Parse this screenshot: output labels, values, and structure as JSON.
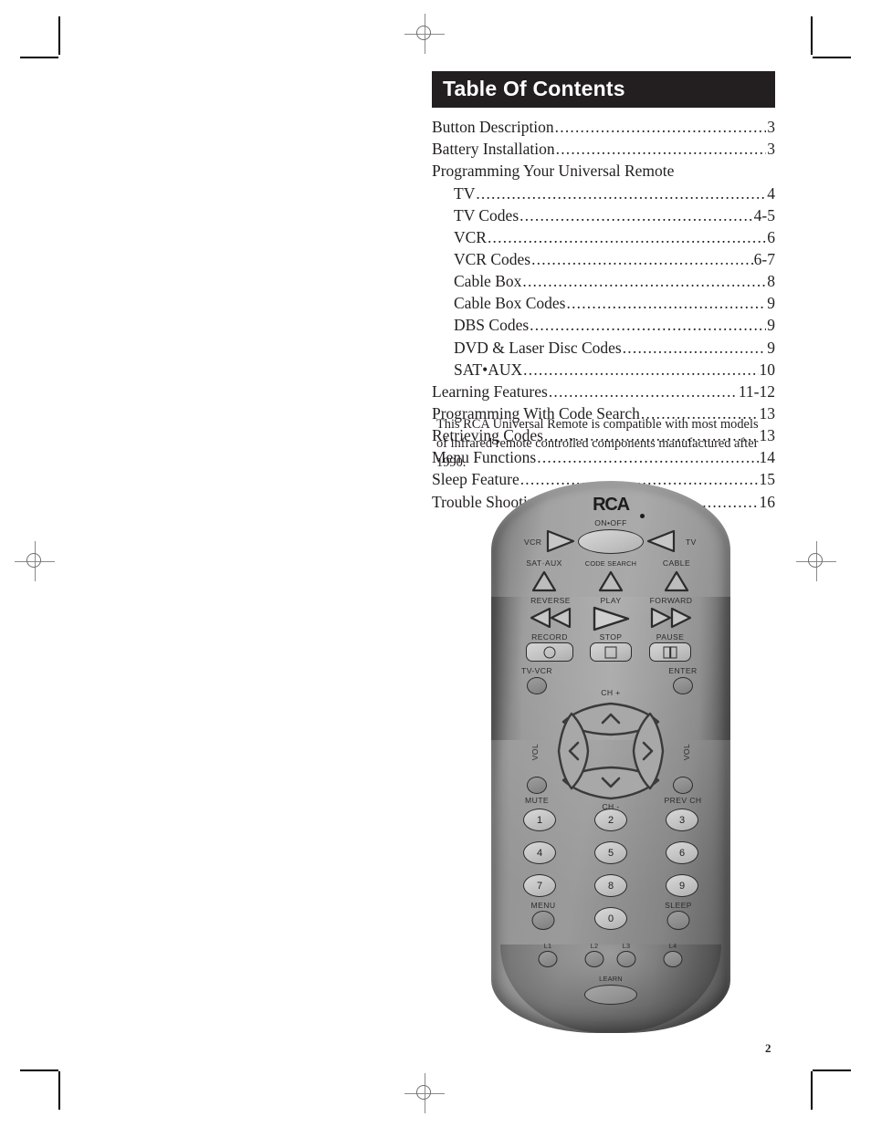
{
  "document": {
    "page_number": "2"
  },
  "toc": {
    "header": "Table Of Contents",
    "entries": [
      {
        "label": "Button Description",
        "page": "3",
        "indent": false,
        "dots": true
      },
      {
        "label": "Battery Installation",
        "page": "3",
        "indent": false,
        "dots": true
      },
      {
        "label": "Programming Your Universal Remote",
        "page": "",
        "indent": false,
        "dots": false
      },
      {
        "label": "TV",
        "page": "4",
        "indent": true,
        "dots": true
      },
      {
        "label": "TV Codes",
        "page": "4-5",
        "indent": true,
        "dots": true
      },
      {
        "label": "VCR",
        "page": "6",
        "indent": true,
        "dots": true
      },
      {
        "label": "VCR Codes",
        "page": "6-7",
        "indent": true,
        "dots": true
      },
      {
        "label": "Cable Box",
        "page": "8",
        "indent": true,
        "dots": true
      },
      {
        "label": "Cable Box Codes",
        "page": "9",
        "indent": true,
        "dots": true
      },
      {
        "label": "DBS Codes",
        "page": "9",
        "indent": true,
        "dots": true
      },
      {
        "label": "DVD & Laser Disc Codes",
        "page": "9",
        "indent": true,
        "dots": true
      },
      {
        "label": "SAT•AUX",
        "page": "10",
        "indent": true,
        "dots": true
      },
      {
        "label": "Learning Features",
        "page": "11-12",
        "indent": false,
        "dots": true
      },
      {
        "label": "Programming With Code Search",
        "page": "13",
        "indent": false,
        "dots": true
      },
      {
        "label": "Retrieving Codes",
        "page": "13",
        "indent": false,
        "dots": true
      },
      {
        "label": "Menu Functions",
        "page": "14",
        "indent": false,
        "dots": true
      },
      {
        "label": "Sleep Feature",
        "page": "15",
        "indent": false,
        "dots": true
      },
      {
        "label": "Trouble Shooting",
        "page": "16",
        "indent": false,
        "dots": true
      }
    ],
    "note": "This RCA Universal Remote is compatible with most models of infrared remote controlled components manufactured after 1990."
  },
  "remote": {
    "brand": "RCA",
    "labels": {
      "on_off": "ON•OFF",
      "vcr": "VCR",
      "tv": "TV",
      "sat_aux": "SAT·AUX",
      "code_search": "CODE SEARCH",
      "cable": "CABLE",
      "reverse": "REVERSE",
      "play": "PLAY",
      "forward": "FORWARD",
      "record": "RECORD",
      "stop": "STOP",
      "pause": "PAUSE",
      "tv_vcr": "TV-VCR",
      "enter": "ENTER",
      "ch_up": "CH +",
      "ch_down": "CH -",
      "vol_left": "VOL",
      "vol_right": "VOL",
      "mute": "MUTE",
      "prev_ch": "PREV CH",
      "menu": "MENU",
      "sleep": "SLEEP",
      "learn": "LEARN",
      "l1": "L1",
      "l2": "L2",
      "l3": "L3",
      "l4": "L4"
    },
    "keypad": [
      "1",
      "2",
      "3",
      "4",
      "5",
      "6",
      "7",
      "8",
      "9",
      "0"
    ]
  },
  "colors": {
    "header_bar": "#231f20",
    "header_text": "#ffffff",
    "body_text": "#231f20",
    "remote_shell": "#8e8e8e",
    "button_face": "#c9c9c9",
    "button_stroke": "#2c2c2c"
  }
}
